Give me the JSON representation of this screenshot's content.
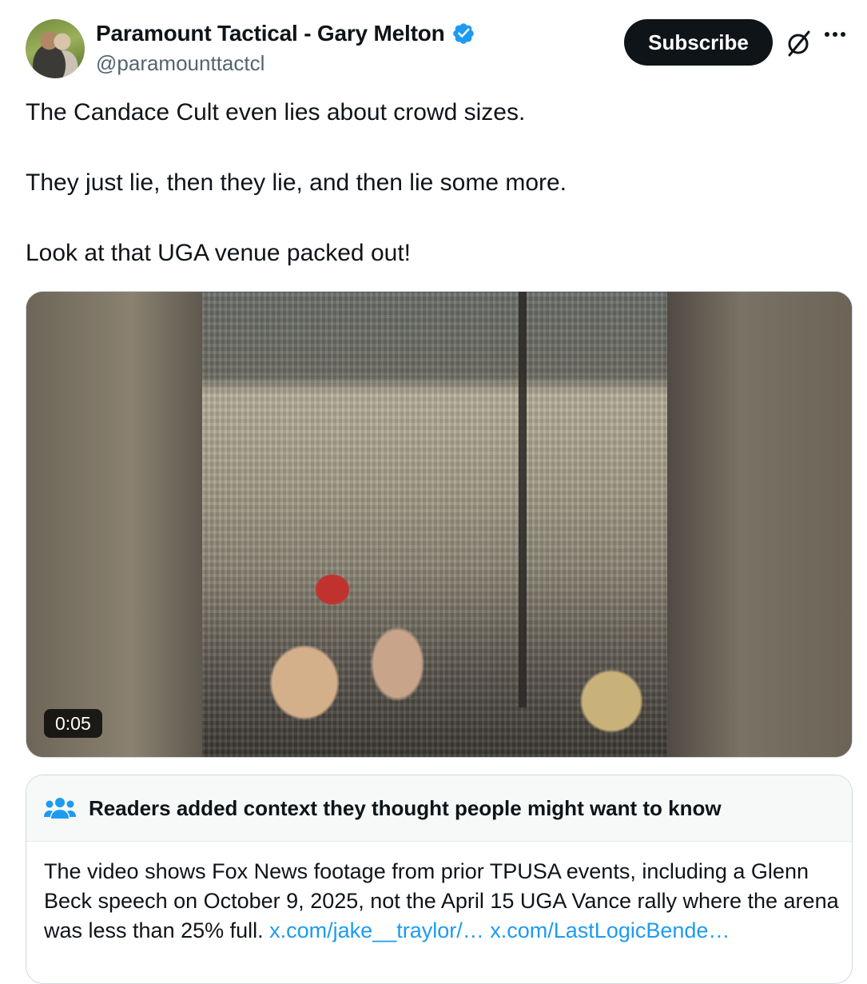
{
  "author": {
    "display_name": "Paramount Tactical - Gary Melton",
    "handle": "@paramounttactcl",
    "verified_color": "#1d9bf0"
  },
  "actions": {
    "subscribe_label": "Subscribe",
    "grok_icon": "grok-icon",
    "more_icon": "more-icon"
  },
  "tweet": {
    "lines": [
      "The Candace Cult even lies about crowd sizes.",
      "They just lie, then they lie, and then lie some more.",
      "Look at that UGA venue packed out!"
    ]
  },
  "media": {
    "type": "video",
    "timestamp": "0:05"
  },
  "community_note": {
    "title": "Readers added context they thought people might want to know",
    "body_text": "The video shows Fox News footage from prior TPUSA events, including a Glenn Beck speech on October 9, 2025, not the April 15 UGA Vance rally where the arena was less than 25% full.",
    "links": [
      "x.com/jake__traylor/…",
      "x.com/LastLogicBende…"
    ],
    "icon": "people-icon",
    "link_color": "#1d9bf0"
  }
}
